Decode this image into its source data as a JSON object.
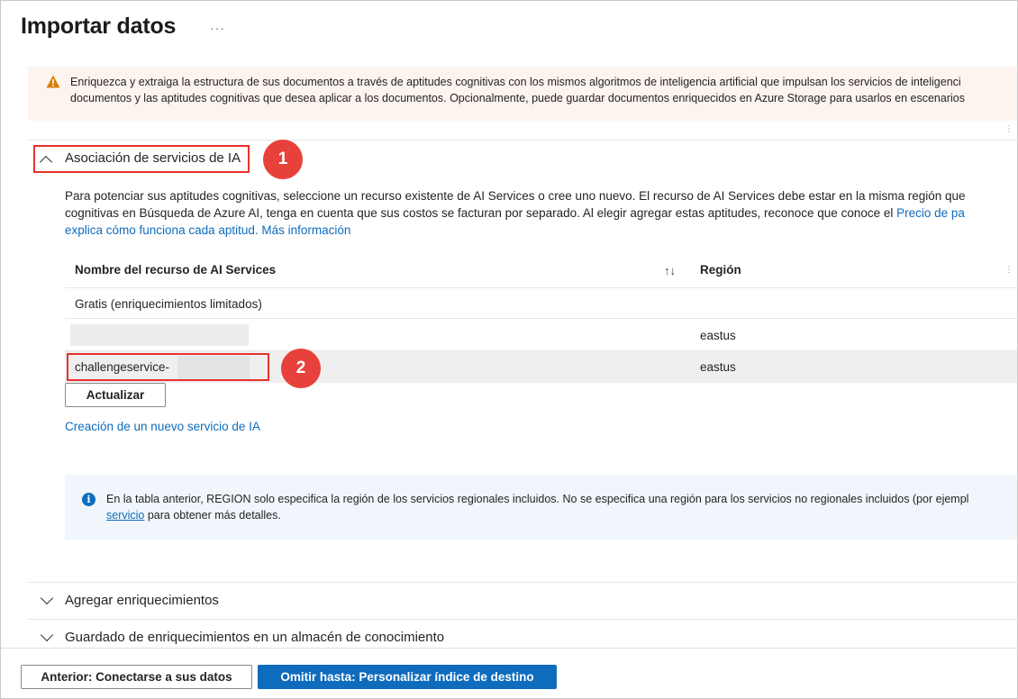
{
  "page": {
    "title": "Importar datos",
    "more_label": "···"
  },
  "warning": {
    "line1": "Enriquezca y extraiga la estructura de sus documentos a través de aptitudes cognitivas con los mismos algoritmos de inteligencia artificial que impulsan los servicios de inteligenci",
    "line2": "documentos y las aptitudes cognitivas que desea aplicar a los documentos. Opcionalmente, puede guardar documentos enriquecidos en Azure Storage para usarlos en escenarios",
    "color": "#fdf4ef"
  },
  "ai_section": {
    "title": "Asociación de servicios de IA",
    "badge": "1",
    "desc_line1": "Para potenciar sus aptitudes cognitivas, seleccione un recurso existente de AI Services o cree uno nuevo. El recurso de AI Services debe estar en la misma región que",
    "desc_line2_text": "cognitivas en Búsqueda de Azure AI, tenga en cuenta que sus costos se facturan por separado. Al elegir agregar estas aptitudes, reconoce que conoce el ",
    "desc_line2_link": "Precio de pa",
    "desc_line3_link": "explica cómo funciona cada aptitud.",
    "desc_line3_link2": "Más información",
    "table": {
      "col_name": "Nombre del recurso de AI Services",
      "col_region": "Región",
      "free_row": "Gratis (enriquecimientos limitados)",
      "rows": [
        {
          "name": "",
          "region": "eastus"
        },
        {
          "name": "challengeservice-",
          "region": "eastus"
        }
      ]
    },
    "badge2": "2",
    "refresh_label": "Actualizar",
    "create_link": "Creación de un nuevo servicio de IA",
    "info_line1": "En la tabla anterior, REGION solo especifica la región de los servicios regionales incluidos. No se especifica una región para los servicios no regionales incluidos (por ejempl",
    "info_line2_link": "servicio",
    "info_line2_text": " para obtener más detalles."
  },
  "sections": {
    "enrich": "Agregar enriquecimientos",
    "store": "Guardado de enriquecimientos en un almacén de conocimiento"
  },
  "footer": {
    "prev_label": "Anterior: Conectarse a sus datos",
    "next_label": "Omitir hasta: Personalizar índice de destino"
  },
  "colors": {
    "accent": "#0f6cbd",
    "highlight": "#e8322b",
    "badge": "#e8413b"
  }
}
